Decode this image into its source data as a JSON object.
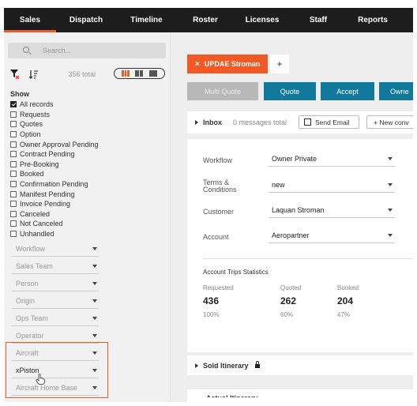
{
  "nav": {
    "tabs": [
      {
        "label": "Sales"
      },
      {
        "label": "Dispatch"
      },
      {
        "label": "Timeline"
      },
      {
        "label": "Roster"
      },
      {
        "label": "Licenses"
      },
      {
        "label": "Staff"
      },
      {
        "label": "Reports"
      }
    ],
    "active_index": 0,
    "accent_color": "#f15a24"
  },
  "sidebar": {
    "search": {
      "placeholder": "Search..."
    },
    "total_label": "356 total",
    "show_label": "Show",
    "checklist": [
      {
        "label": "All records",
        "checked": true
      },
      {
        "label": "Requests",
        "checked": false
      },
      {
        "label": "Quotes",
        "checked": false
      },
      {
        "label": "Option",
        "checked": false
      },
      {
        "label": "Owner Approval Pending",
        "checked": false
      },
      {
        "label": "Contract Pending",
        "checked": false
      },
      {
        "label": "Pre-Booking",
        "checked": false
      },
      {
        "label": "Booked",
        "checked": false
      },
      {
        "label": "Confirmation Pending",
        "checked": false
      },
      {
        "label": "Manifest Pending",
        "checked": false
      },
      {
        "label": "Invoice Pending",
        "checked": false
      },
      {
        "label": "Canceled",
        "checked": false
      },
      {
        "label": "Not Canceled",
        "checked": false
      },
      {
        "label": "Unhandled",
        "checked": false
      }
    ],
    "filters": [
      {
        "label": "Workflow"
      },
      {
        "label": "Sales Team"
      },
      {
        "label": "Person"
      },
      {
        "label": "Origin"
      },
      {
        "label": "Ops Team"
      },
      {
        "label": "Operator"
      },
      {
        "label": "Aircraft"
      },
      {
        "label": "xPiston"
      },
      {
        "label": "Aircraft Home Base"
      }
    ]
  },
  "main": {
    "doc_tab": {
      "close": "×",
      "label": "UPDAE Stroman"
    },
    "add_tab": "+",
    "actions": [
      {
        "label": "Multi Quote",
        "disabled": true
      },
      {
        "label": "Quote",
        "disabled": false
      },
      {
        "label": "Accept",
        "disabled": false
      },
      {
        "label": "Owne",
        "disabled": false
      }
    ],
    "inbox": {
      "title": "Inbox",
      "messages": "0 messages total",
      "send_email": "Send Email",
      "new_conversation": "+ New conv"
    },
    "fields": [
      {
        "label": "Workflow",
        "value": "Owner Private"
      },
      {
        "label": "Terms & Conditions",
        "value": "new"
      },
      {
        "label": "Customer",
        "value": "Laquan Stroman"
      },
      {
        "label": "Account",
        "value": "Aeropartner"
      }
    ],
    "stats": {
      "title": "Account Trips Statistics",
      "columns": [
        {
          "label": "Requested",
          "value": "436",
          "percent": "100%"
        },
        {
          "label": "Quoted",
          "value": "262",
          "percent": "60%"
        },
        {
          "label": "Booked",
          "value": "204",
          "percent": "47%"
        }
      ]
    },
    "sold_itinerary": {
      "title": "Sold Itinerary"
    },
    "partial_section": {
      "title": "Actual Itinerary"
    }
  }
}
